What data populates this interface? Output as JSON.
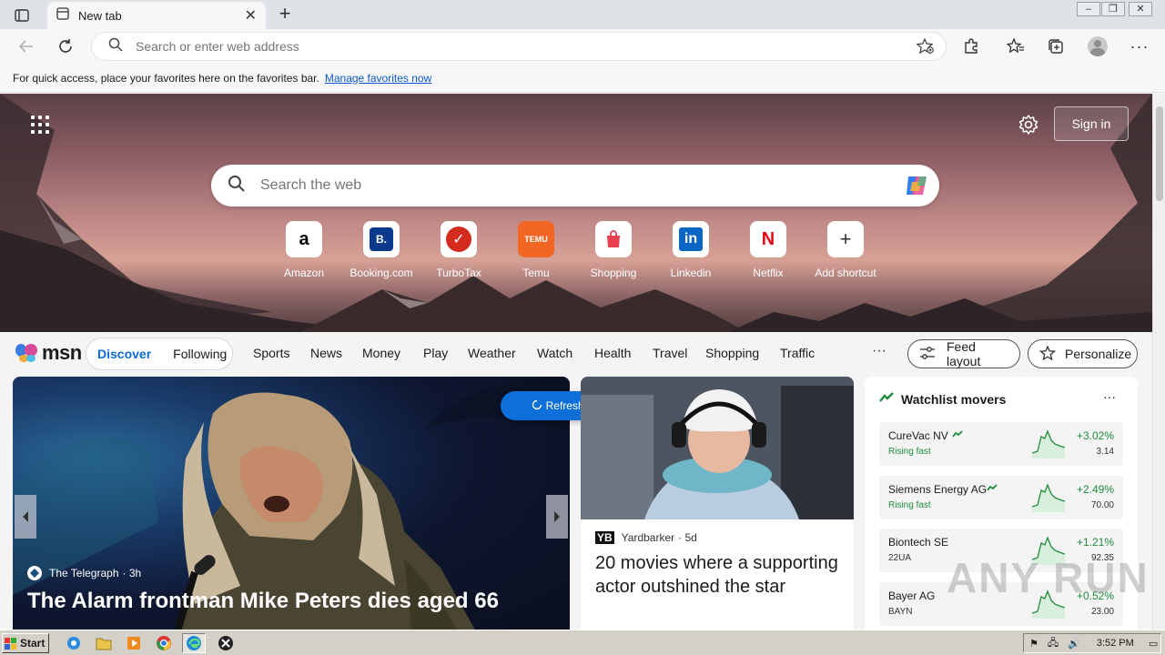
{
  "browser": {
    "tab_title": "New tab",
    "address_placeholder": "Search or enter web address",
    "favbar_text": "For quick access, place your favorites here on the favorites bar.",
    "favbar_link": "Manage favorites now"
  },
  "hero": {
    "signin_label": "Sign in",
    "search_placeholder": "Search the web",
    "shortcuts": [
      {
        "label": "Amazon",
        "glyph": "a",
        "color": "#000000"
      },
      {
        "label": "Booking.com",
        "glyph": "B.",
        "color": "#0a3a8c"
      },
      {
        "label": "TurboTax",
        "glyph": "✓",
        "color": "#d52b1e"
      },
      {
        "label": "Temu",
        "glyph": "TEMU",
        "color": "#f26522"
      },
      {
        "label": "Shopping",
        "glyph": "🛍",
        "color": "#e8414f"
      },
      {
        "label": "Linkedin",
        "glyph": "in",
        "color": "#0a66c2"
      },
      {
        "label": "Netflix",
        "glyph": "N",
        "color": "#e50914"
      },
      {
        "label": "Add shortcut",
        "glyph": "+",
        "color": "#333333"
      }
    ]
  },
  "msn": {
    "logo_text": "msn",
    "segments": [
      "Discover",
      "Following"
    ],
    "nav": [
      "Sports",
      "News",
      "Money",
      "Play",
      "Weather",
      "Watch",
      "Health",
      "Travel",
      "Shopping",
      "Traffic"
    ],
    "more_label": "···",
    "feed_layout_label": "Feed layout",
    "personalize_label": "Personalize"
  },
  "cards": {
    "refresh_label": "Refresh stories",
    "hero_source": "The Telegraph",
    "hero_age": "· 3h",
    "hero_title": "The Alarm frontman Mike Peters dies aged 66",
    "yb_source": "Yardbarker",
    "yb_age": "· 5d",
    "yb_title": "20 movies where a supporting actor outshined the star"
  },
  "watchlist": {
    "title": "Watchlist movers",
    "menu": "···",
    "stocks": [
      {
        "name": "CureVac NV",
        "sub": "Rising fast",
        "pct": "+3.02%",
        "value": "3.14",
        "rising": true
      },
      {
        "name": "Siemens Energy AG",
        "sub": "Rising fast",
        "pct": "+2.49%",
        "value": "70.00",
        "rising": true
      },
      {
        "name": "Biontech SE",
        "sub": "22UA",
        "pct": "+1.21%",
        "value": "92.35",
        "rising": false
      },
      {
        "name": "Bayer AG",
        "sub": "BAYN",
        "pct": "+0.52%",
        "value": "23.00",
        "rising": false
      }
    ]
  },
  "taskbar": {
    "start_label": "Start",
    "clock": "3:52 PM"
  },
  "watermark": "ANY RUN",
  "colors": {
    "accent": "#0e6fd8",
    "positive": "#1f8b3d"
  }
}
